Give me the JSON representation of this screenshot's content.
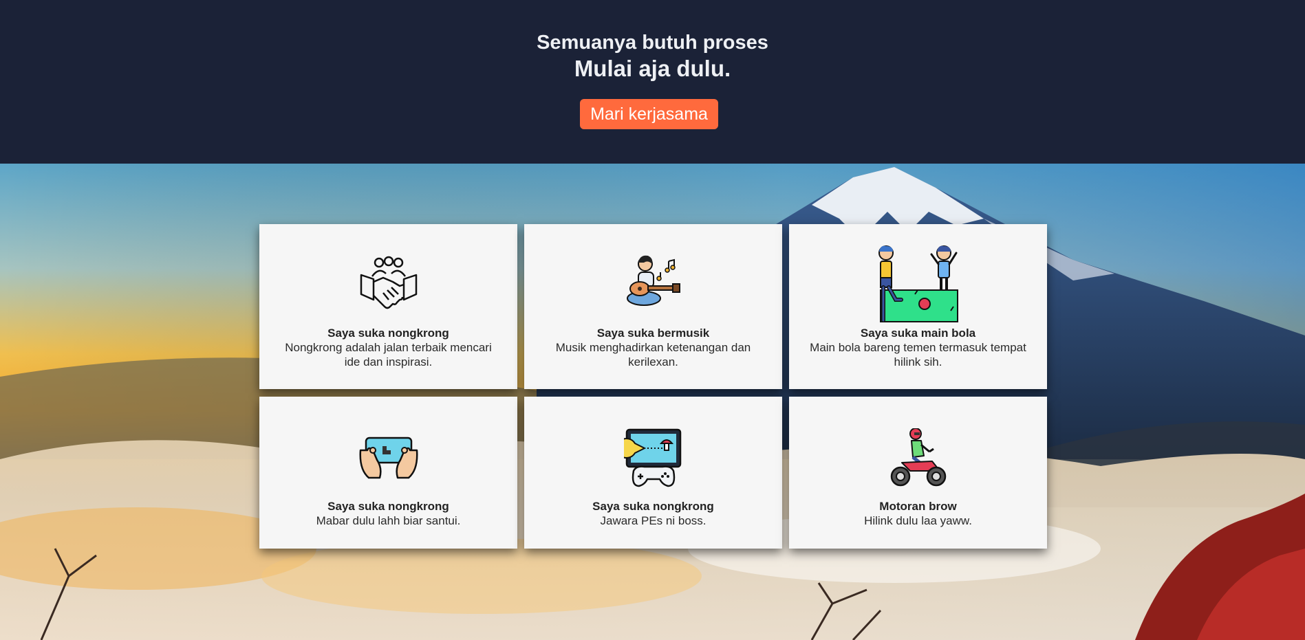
{
  "hero": {
    "subtitle": "Semuanya butuh proses",
    "title": "Mulai aja dulu.",
    "cta_label": "Mari kerjasama",
    "background_color": "#1b2237",
    "cta_color": "#ff6a3d"
  },
  "scenery": {
    "icon": "mountain-sunrise-background"
  },
  "cards": [
    {
      "icon": "handshake-icon",
      "title": "Saya suka nongkrong",
      "description": "Nongkrong adalah jalan terbaik mencari ide dan inspirasi."
    },
    {
      "icon": "guitar-player-icon",
      "title": "Saya suka bermusik",
      "description": "Musik menghadirkan ketenangan dan kerilexan."
    },
    {
      "icon": "football-players-icon",
      "title": "Saya suka main bola",
      "description": "Main bola bareng temen termasuk tempat hilink sih."
    },
    {
      "icon": "mobile-gaming-icon",
      "title": "Saya suka nongkrong",
      "description": "Mabar dulu lahh biar santui."
    },
    {
      "icon": "game-console-icon",
      "title": "Saya suka nongkrong",
      "description": "Jawara PEs ni boss."
    },
    {
      "icon": "motorcycle-rider-icon",
      "title": "Motoran brow",
      "description": "Hilink dulu laa yaww."
    }
  ]
}
